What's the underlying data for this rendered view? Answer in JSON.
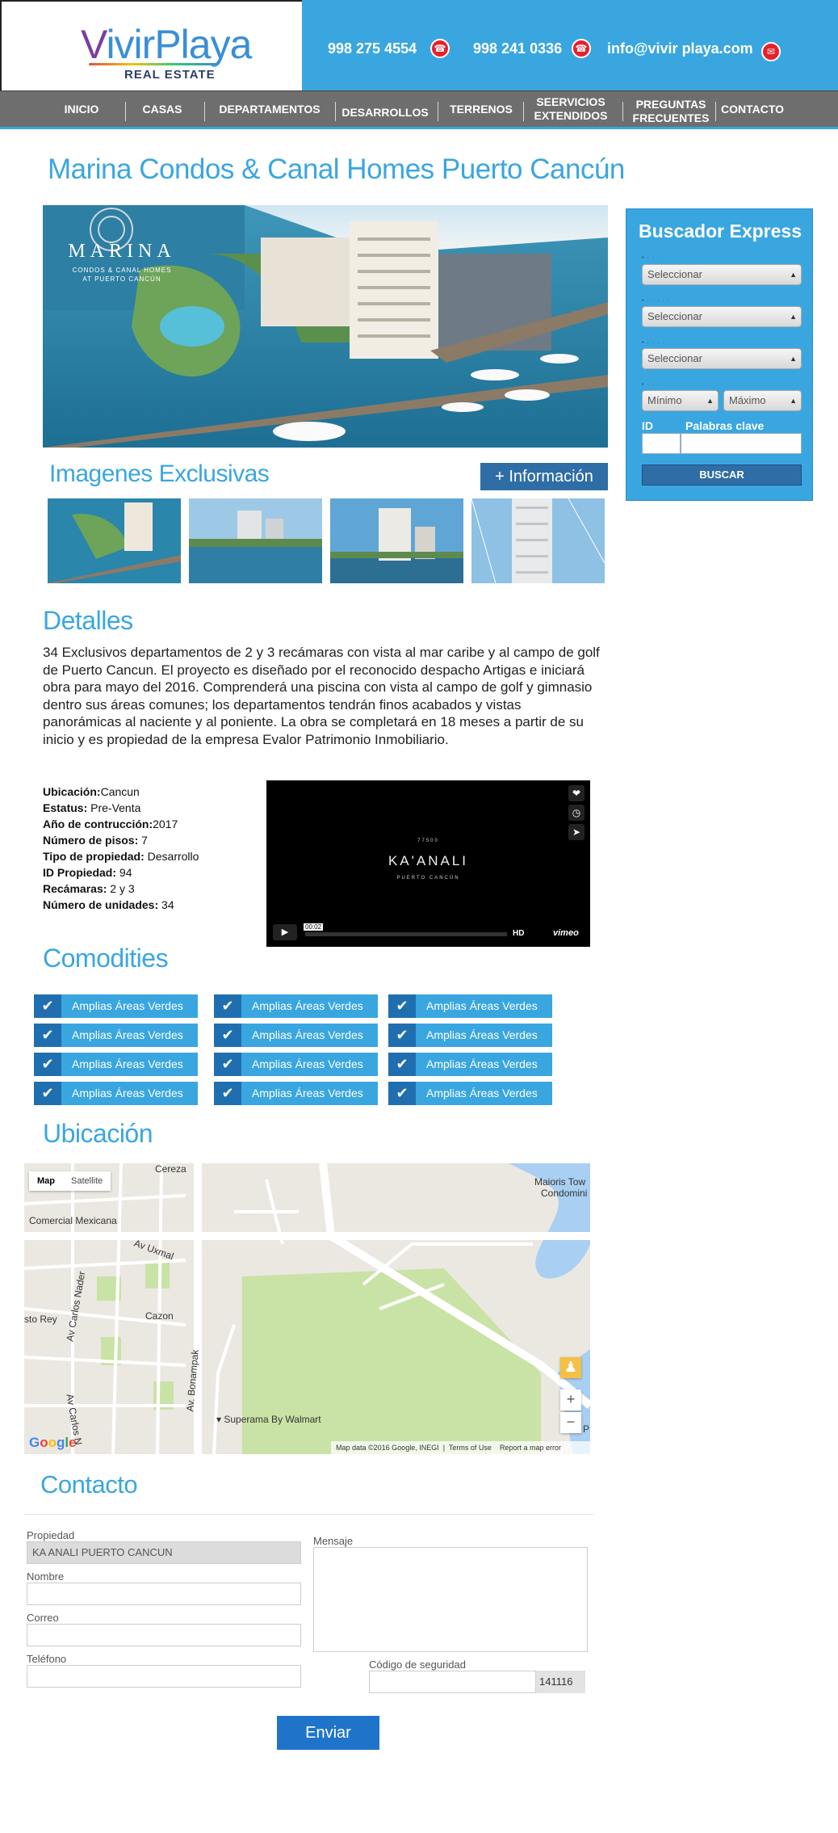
{
  "brand": {
    "name_first": "V",
    "name_rest": "ivirPlaya",
    "subtitle": "REAL ESTATE"
  },
  "header": {
    "phone1": "998 275 4554",
    "phone2": "998 241 0336",
    "email": "info@vivir playa.com"
  },
  "nav": [
    "INICIO",
    "CASAS",
    "DEPARTAMENTOS",
    "DESARROLLOS",
    "TERRENOS",
    "SEERVICIOS\nEXTENDIDOS",
    "PREGUNTAS\nFRECUENTES",
    "CONTACTO"
  ],
  "page_title": "Marina Condos & Canal Homes Puerto Cancún",
  "hero": {
    "label_big": "MARINA",
    "label_small": "CONDOS & CANAL HOMES\nAT PUERTO CANCÚN"
  },
  "gallery": {
    "title": "Imagenes Exclusivas",
    "info_button": "+ Información"
  },
  "sidebar": {
    "title": "Buscador Express",
    "select_placeholder": "Seleccionar",
    "min_label": "Mínimo",
    "max_label": "Máximo",
    "id_label": "ID",
    "keywords_label": "Palabras clave",
    "search_button": "BUSCAR"
  },
  "details": {
    "title": "Detalles",
    "description": "34 Exclusivos departamentos de 2 y 3 recámaras con vista al mar caribe y al campo de golf de Puerto Cancun. El proyecto es diseñado por el reconocido despacho Artigas e iniciará obra para mayo del 2016. Comprenderá una piscina con vista al campo de golf y gimnasio dentro sus áreas comunes; los departamentos tendrán finos acabados y vistas panorámicas al naciente y al poniente. La obra se completará en 18 meses a partir de su inicio y es propiedad de la empresa Evalor Patrimonio Inmobiliario.",
    "specs": [
      {
        "label": "Ubicación:",
        "value": "Cancun"
      },
      {
        "label": "Estatus:",
        "value": " Pre-Venta"
      },
      {
        "label": "Año de contrucción:",
        "value": "2017"
      },
      {
        "label": "Número de pisos:",
        "value": " 7"
      },
      {
        "label": "Tipo de propiedad:",
        "value": " Desarrollo"
      },
      {
        "label": "ID Propiedad:",
        "value": " 94"
      },
      {
        "label": "Recámaras:",
        "value": " 2 y 3"
      },
      {
        "label": "Número de unidades:",
        "value": " 34"
      }
    ]
  },
  "video": {
    "top_text": "77500",
    "title": "KA'ANALI",
    "subtitle": "PUERTO CANCÚN",
    "time": "00:02",
    "hd": "HD",
    "provider": "vimeo"
  },
  "amenities": {
    "title": "Comodities",
    "items": [
      "Amplias Áreas Verdes",
      "Amplias Áreas Verdes",
      "Amplias Áreas Verdes",
      "Amplias Áreas Verdes",
      "Amplias Áreas Verdes",
      "Amplias Áreas Verdes",
      "Amplias Áreas Verdes",
      "Amplias Áreas Verdes",
      "Amplias Áreas Verdes",
      "Amplias Áreas Verdes",
      "Amplias Áreas Verdes",
      "Amplias Áreas Verdes"
    ]
  },
  "location": {
    "title": "Ubicación",
    "map_tab": "Map",
    "satellite_tab": "Satellite",
    "labels": {
      "cereza": "Cereza",
      "maioris": "Maioris Tow",
      "condomini": "Condomini",
      "comercial": "Comercial Mexicana",
      "uxmal": "Av Uxmal",
      "carlos_nader": "Av Carlos Nader",
      "carlos_nader2": "Av Carlos N",
      "sto_rey": "sto Rey",
      "cazon": "Cazon",
      "bonampak": "Av. Bonampak",
      "superama": "Superama By Walmart",
      "p": "P"
    },
    "footer": {
      "data": "Map data ©2016 Google, INEGI",
      "terms": "Terms of Use",
      "report": "Report a map error"
    },
    "google": "Google"
  },
  "contact": {
    "title": "Contacto",
    "property_label": "Propiedad",
    "property_value": "KA ANALI PUERTO CANCUN",
    "name_label": "Nombre",
    "email_label": "Correo",
    "phone_label": "Teléfono",
    "message_label": "Mensaje",
    "security_label": "Código de seguridad",
    "security_code": "141116",
    "submit": "Enviar"
  },
  "colors": {
    "accent": "#3aa6e0",
    "nav": "#6e6e6e",
    "dark_blue": "#2f6da6"
  }
}
